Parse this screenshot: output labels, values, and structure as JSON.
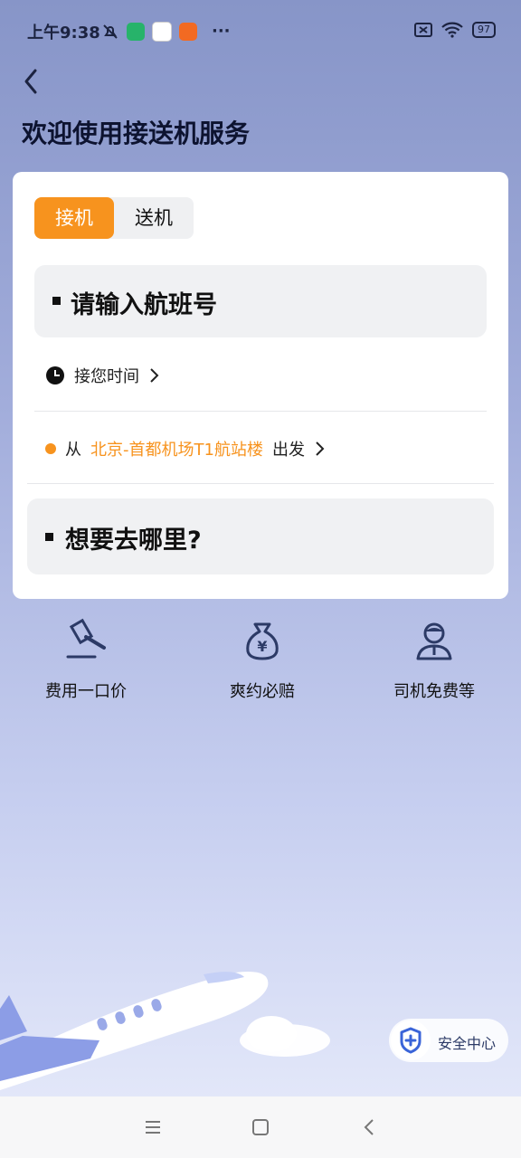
{
  "status_bar": {
    "time": "上午9:38",
    "battery": "97",
    "icons": [
      "mute-icon",
      "shield-app-icon",
      "qq-icon",
      "app-icon",
      "more-icon",
      "sim-icon",
      "wifi-icon",
      "battery-icon"
    ]
  },
  "header": {
    "title": "欢迎使用接送机服务"
  },
  "tabs": [
    {
      "label": "接机",
      "active": true
    },
    {
      "label": "送机",
      "active": false
    }
  ],
  "flight_input": {
    "placeholder": "请输入航班号"
  },
  "pickup_time": {
    "label": "接您时间"
  },
  "departure": {
    "prefix": "从",
    "location": "北京-首都机场T1航站楼",
    "suffix": "出发"
  },
  "destination": {
    "placeholder": "想要去哪里?"
  },
  "features": [
    {
      "label": "费用一口价",
      "icon": "gavel-icon"
    },
    {
      "label": "爽约必赔",
      "icon": "money-bag-icon"
    },
    {
      "label": "司机免费等",
      "icon": "driver-icon"
    }
  ],
  "safety": {
    "label": "安全中心",
    "icon": "shield-plus-icon"
  },
  "colors": {
    "accent": "#f7931e",
    "primary_text": "#111111",
    "icon_blue": "#2c3a66"
  }
}
